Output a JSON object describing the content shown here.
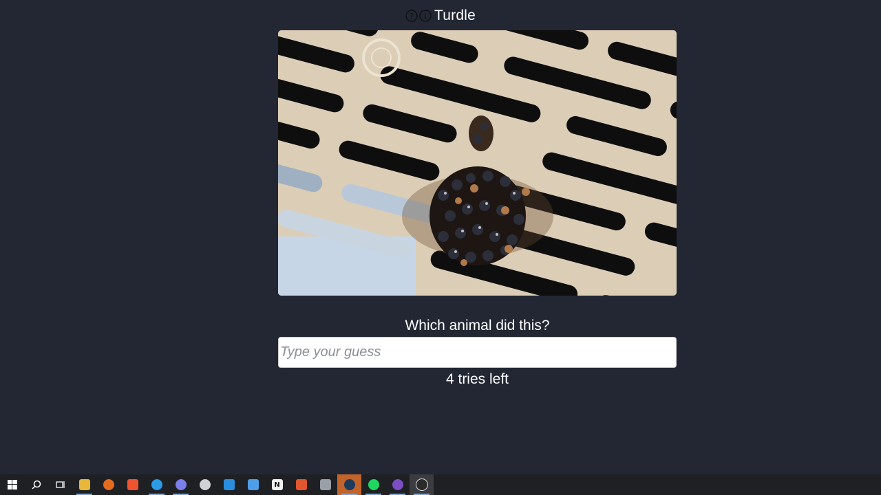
{
  "header": {
    "title": "Turdle",
    "icons": [
      "help-icon",
      "info-icon"
    ]
  },
  "game": {
    "question": "Which animal did this?",
    "input_placeholder": "Type your guess",
    "input_value": "",
    "tries_left_text": "4 tries left"
  },
  "taskbar": {
    "items": [
      {
        "name": "windows-start",
        "icon": "windows-logo-icon"
      },
      {
        "name": "search",
        "icon": "search-icon"
      },
      {
        "name": "task-view",
        "icon": "task-view-icon"
      },
      {
        "name": "file-explorer",
        "icon": "folder-icon"
      },
      {
        "name": "firefox",
        "icon": "firefox-icon"
      },
      {
        "name": "brave",
        "icon": "brave-icon"
      },
      {
        "name": "edge",
        "icon": "edge-icon"
      },
      {
        "name": "discord",
        "icon": "discord-icon"
      },
      {
        "name": "app-circle",
        "icon": "globe-icon"
      },
      {
        "name": "vscode",
        "icon": "vscode-icon"
      },
      {
        "name": "app-blue",
        "icon": "app-icon"
      },
      {
        "name": "notion",
        "icon": "notion-icon"
      },
      {
        "name": "app-orange",
        "icon": "app-icon"
      },
      {
        "name": "app-grey",
        "icon": "app-icon"
      },
      {
        "name": "steam",
        "icon": "steam-icon"
      },
      {
        "name": "spotify",
        "icon": "spotify-icon"
      },
      {
        "name": "github",
        "icon": "github-icon"
      },
      {
        "name": "obs",
        "icon": "obs-icon"
      }
    ]
  },
  "colors": {
    "background": "#222733",
    "taskbar": "#1e2024",
    "text": "#ffffff"
  }
}
